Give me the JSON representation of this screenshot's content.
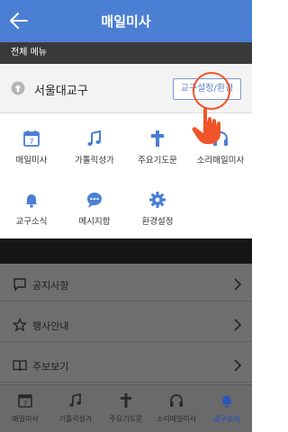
{
  "colors": {
    "header": "#4a7fd4",
    "accent": "#4a7fd4",
    "highlight": "#f0552a",
    "overlay": "#6f6f6f",
    "active_tab": "#2b56b8"
  },
  "header": {
    "title": "매일미사",
    "back_icon": "arrow-left-icon"
  },
  "section": {
    "title": "전체 메뉴"
  },
  "parish": {
    "name": "서울대교구",
    "button_label": "교구설정/환경",
    "icon": "arrow-up-circle-icon"
  },
  "grid": {
    "items": [
      {
        "label": "매일미사",
        "icon": "calendar-icon"
      },
      {
        "label": "가톨릭성가",
        "icon": "music-note-icon"
      },
      {
        "label": "주요기도문",
        "icon": "cross-icon"
      },
      {
        "label": "소리매일미사",
        "icon": "headphones-icon"
      },
      {
        "label": "교구소식",
        "icon": "bell-icon"
      },
      {
        "label": "메시지함",
        "icon": "chat-bubble-icon"
      },
      {
        "label": "환경설정",
        "icon": "gear-icon"
      }
    ]
  },
  "menu": {
    "items": [
      {
        "label": "공지사항",
        "icon": "message-square-icon"
      },
      {
        "label": "행사안내",
        "icon": "star-icon"
      },
      {
        "label": "주보보기",
        "icon": "book-icon"
      }
    ]
  },
  "tabbar": {
    "items": [
      {
        "label": "매일미사",
        "icon": "calendar-icon",
        "active": false
      },
      {
        "label": "가톨릭성가",
        "icon": "music-note-icon",
        "active": false
      },
      {
        "label": "주요기도문",
        "icon": "cross-icon",
        "active": false
      },
      {
        "label": "소리매일미사",
        "icon": "headphones-icon",
        "active": false
      },
      {
        "label": "교구소식",
        "icon": "bell-icon",
        "active": true
      }
    ]
  }
}
